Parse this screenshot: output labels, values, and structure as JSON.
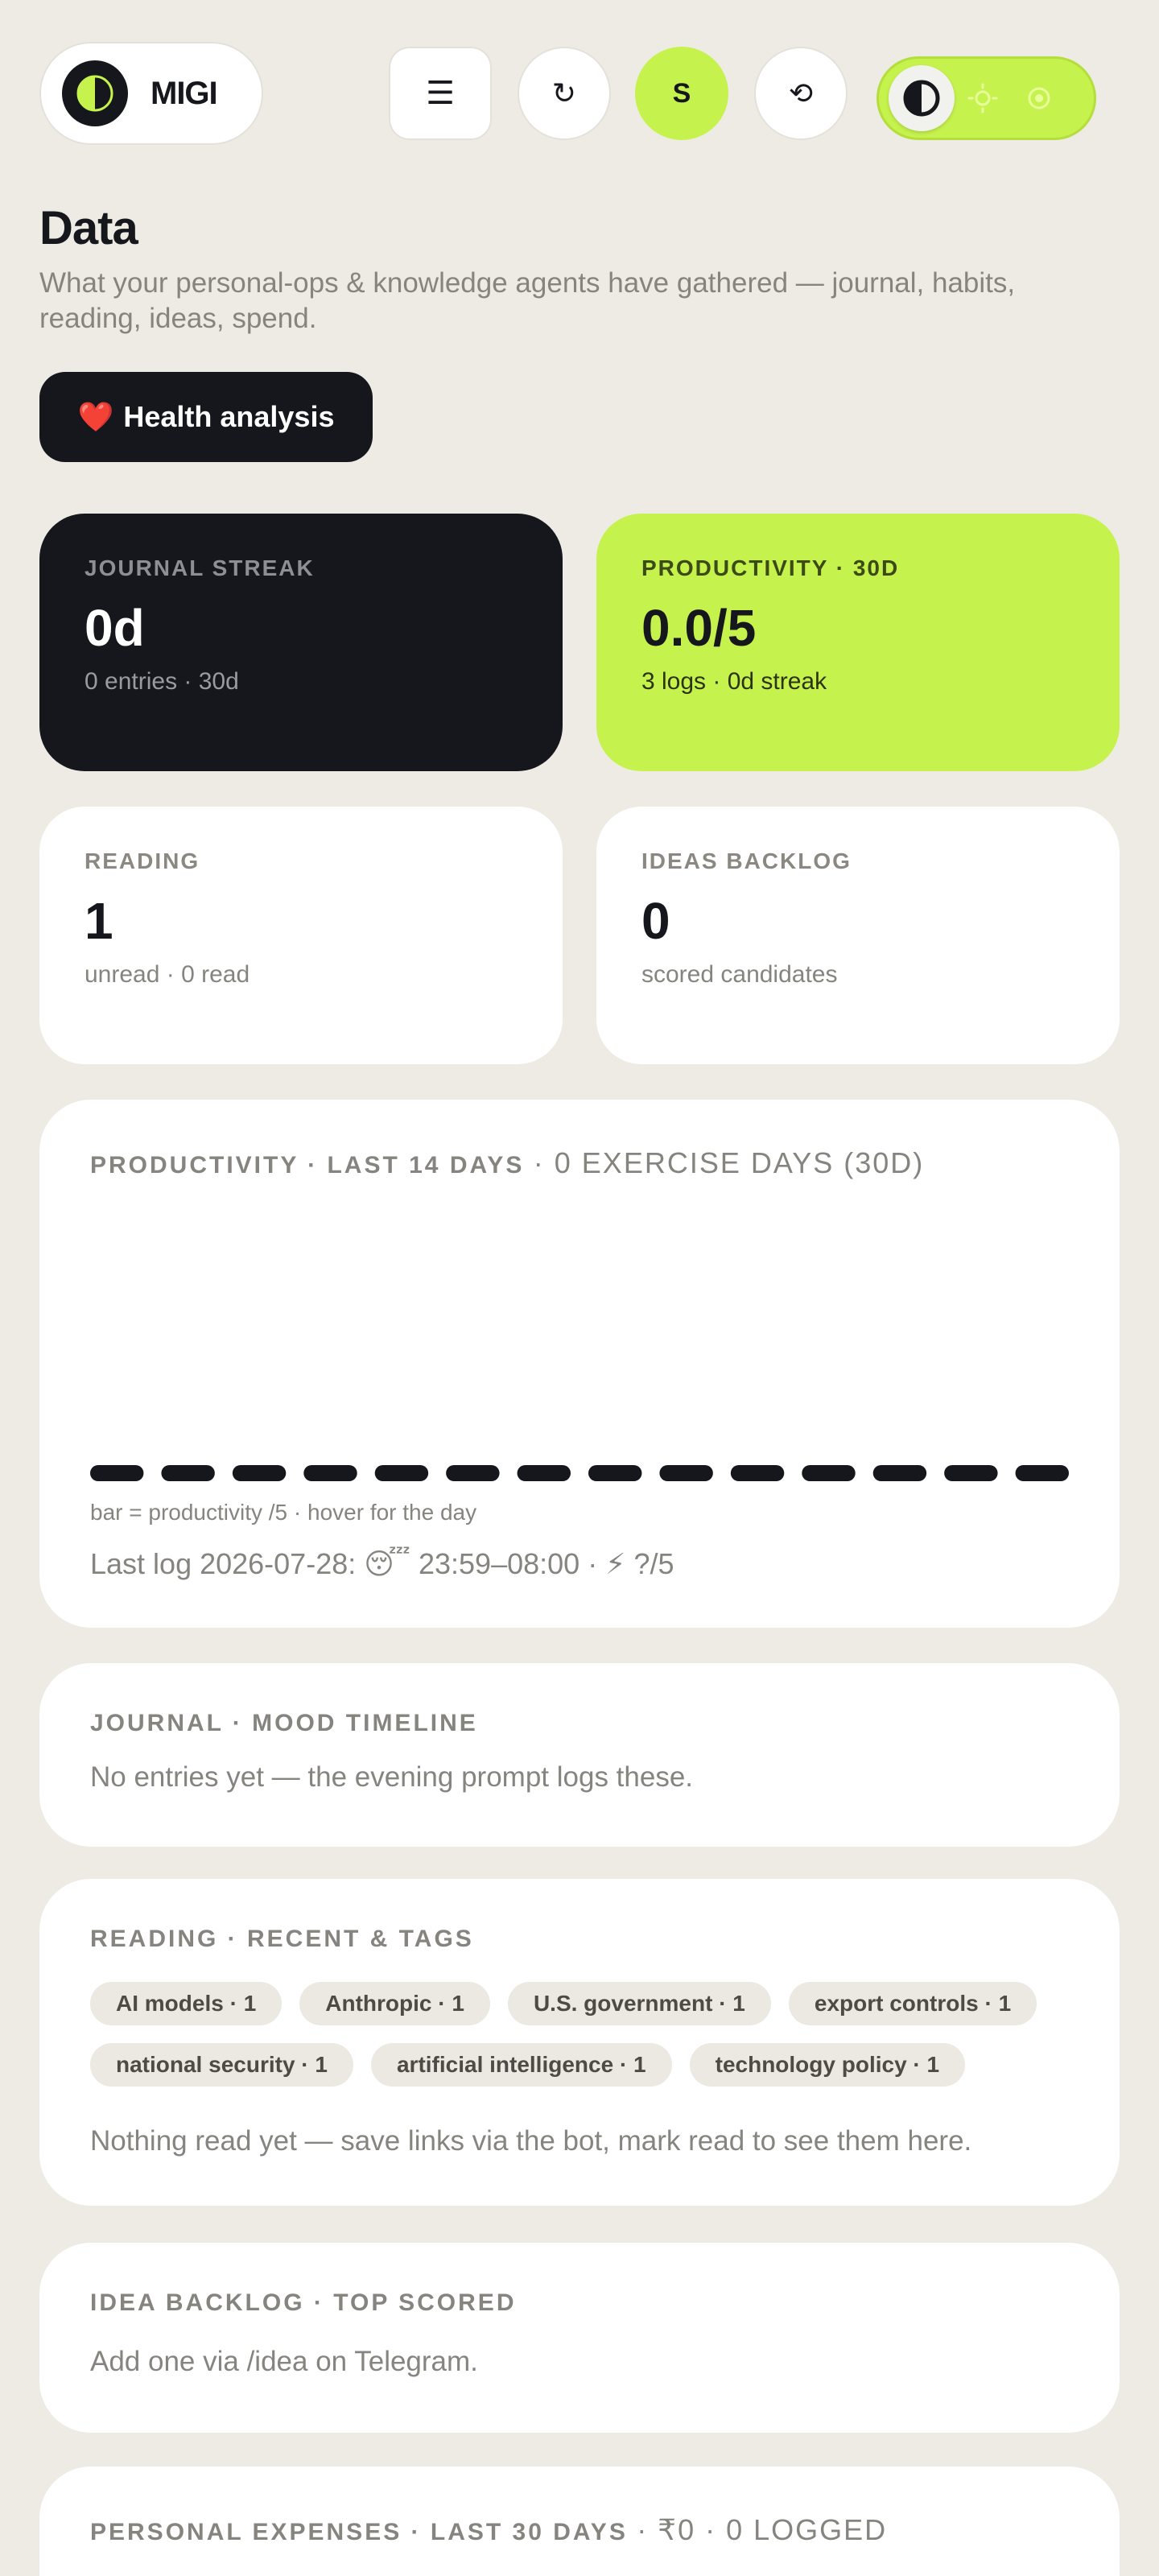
{
  "header": {
    "brand": {
      "name": "MIGI"
    },
    "buttons": {
      "menu": {
        "glyph": "☰"
      },
      "refresh": {
        "glyph": "↻"
      },
      "profile": {
        "label": "S"
      },
      "history": {
        "glyph": "⟲"
      }
    },
    "theme_toggle": {
      "selected": "auto"
    }
  },
  "page": {
    "title": "Data",
    "subtitle": "What your personal-ops & knowledge agents have gathered — journal, habits, reading, ideas, spend.",
    "health_button": {
      "emoji": "❤️",
      "label": "Health analysis"
    }
  },
  "stats": [
    {
      "label": "JOURNAL STREAK",
      "value": "0d",
      "sub": "0 entries · 30d"
    },
    {
      "label": "PRODUCTIVITY · 30D",
      "value": "0.0/5",
      "sub": "3 logs · 0d streak"
    },
    {
      "label": "READING",
      "value": "1",
      "sub": "unread · 0 read"
    },
    {
      "label": "IDEAS BACKLOG",
      "value": "0",
      "sub": "scored candidates"
    }
  ],
  "productivity": {
    "heading_bold": "PRODUCTIVITY · LAST 14 DAYS",
    "heading_light": "· 0 EXERCISE DAYS (30D)",
    "caption": "bar = productivity /5 · hover for the day",
    "last_log": "Last log 2026-07-28: 😴 23:59–08:00 · ⚡ ?/5",
    "chart_data": {
      "type": "bar",
      "categories": [
        "",
        "",
        "",
        "",
        "",
        "",
        "",
        "",
        "",
        "",
        "",
        "",
        "",
        ""
      ],
      "values": [
        0,
        0,
        0,
        0,
        0,
        0,
        0,
        0,
        0,
        0,
        0,
        0,
        0,
        0
      ],
      "ylim": [
        0,
        5
      ],
      "color": "#16171c"
    }
  },
  "journal": {
    "heading": "JOURNAL · MOOD TIMELINE",
    "empty": "No entries yet — the evening prompt logs these."
  },
  "reading": {
    "heading": "READING · RECENT & TAGS",
    "tags": [
      "AI models · 1",
      "Anthropic · 1",
      "U.S. government · 1",
      "export controls · 1",
      "national security · 1",
      "artificial intelligence · 1",
      "technology policy · 1"
    ],
    "empty": "Nothing read yet — save links via the bot, mark read to see them here."
  },
  "ideas": {
    "heading": "IDEA BACKLOG · TOP SCORED",
    "empty": "Add one via /idea on Telegram."
  },
  "expenses": {
    "heading_bold": "PERSONAL EXPENSES · LAST 30 DAYS",
    "heading_light": "· ₹0 · 0 LOGGED"
  },
  "colors": {
    "background": "#eeebe5",
    "accent": "#c6f24e",
    "dark": "#16171c",
    "muted": "#86847e"
  }
}
